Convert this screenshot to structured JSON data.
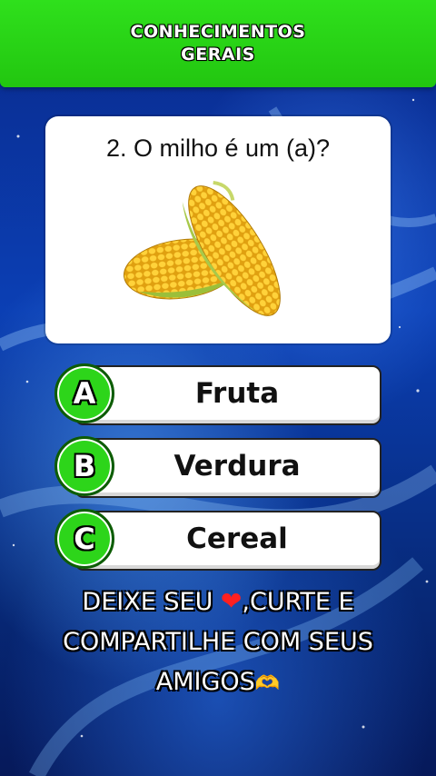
{
  "header": {
    "line1": "CONHECIMENTOS",
    "line2": "GERAIS"
  },
  "question": {
    "text": "2. O milho é um (a)?",
    "image": "corn-image"
  },
  "options": [
    {
      "letter": "A",
      "label": "Fruta"
    },
    {
      "letter": "B",
      "label": "Verdura"
    },
    {
      "letter": "C",
      "label": "Cereal"
    }
  ],
  "cta": {
    "part1": "DEIXE SEU ",
    "heart_icon": "❤",
    "part2": ",CURTE E",
    "line2": "COMPARTILHE COM SEUS",
    "line3": "AMIGOS",
    "hands_icon": "🫶"
  },
  "colors": {
    "header_green": "#2fe01c",
    "circle_green": "#2dd51a",
    "background_blue": "#0b3fb4"
  }
}
